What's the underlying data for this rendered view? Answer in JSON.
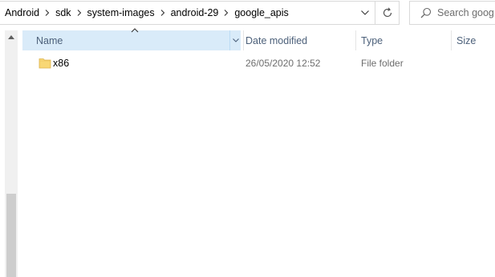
{
  "breadcrumb": {
    "items": [
      {
        "label": "Android"
      },
      {
        "label": "sdk"
      },
      {
        "label": "system-images"
      },
      {
        "label": "android-29"
      },
      {
        "label": "google_apis"
      }
    ]
  },
  "search": {
    "placeholder": "Search goog"
  },
  "columns": {
    "name": "Name",
    "date_modified": "Date modified",
    "type": "Type",
    "size": "Size"
  },
  "files": [
    {
      "name": "x86",
      "date_modified": "26/05/2020 12:52",
      "type": "File folder",
      "size": "",
      "icon": "folder-icon"
    }
  ],
  "colors": {
    "header_selected_bg": "#d9ebf9",
    "header_text": "#4c607a",
    "folder_yellow": "#f8d775"
  }
}
